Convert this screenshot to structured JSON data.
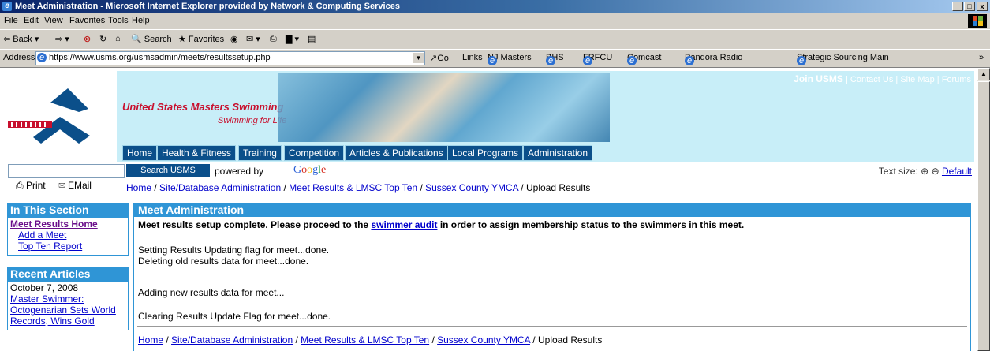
{
  "window": {
    "title": "Meet Administration - Microsoft Internet Explorer provided by Network & Computing Services"
  },
  "menu": [
    "File",
    "Edit",
    "View",
    "Favorites",
    "Tools",
    "Help"
  ],
  "toolbar": {
    "back": "Back",
    "search": "Search",
    "favorites": "Favorites"
  },
  "addressbar": {
    "label": "Address",
    "url": "https://www.usms.org/usmsadmin/meets/resultssetup.php",
    "go": "Go",
    "links_label": "Links",
    "links": [
      "NJ Masters",
      "BHS",
      "FRFCU",
      "Comcast",
      "Pandora Radio",
      "Strategic Sourcing Main"
    ]
  },
  "site": {
    "brand": "United States Masters Swimming",
    "tagline": "Swimming for Life",
    "nav": [
      "Home",
      "Health & Fitness",
      "Training",
      "Competition",
      "Articles & Publications",
      "Local Programs",
      "Administration"
    ],
    "join": "Join USMS",
    "toplinks": [
      "Contact Us",
      "Site Map",
      "Forums"
    ]
  },
  "search": {
    "button": "Search USMS",
    "powered": "powered by",
    "google": "Google",
    "text_size": "Text size:",
    "default": "Default",
    "print": "Print",
    "email": "EMail"
  },
  "breadcrumb": {
    "links": [
      "Home",
      "Site/Database Administration",
      "Meet Results & LMSC Top Ten",
      "Sussex County YMCA"
    ],
    "current": "Upload Results"
  },
  "sidebar": {
    "section_title": "In This Section",
    "section_links": [
      "Meet Results Home",
      "Add a Meet",
      "Top Ten Report"
    ],
    "recent_title": "Recent Articles",
    "date": "October 7, 2008",
    "articles": [
      "Master Swimmer: Octogenarian Sets World Records, Wins Gold"
    ]
  },
  "main": {
    "title": "Meet Administration",
    "msg_pre": "Meet results setup complete. Please proceed to the",
    "msg_link": "swimmer audit",
    "msg_post": "in order to assign membership status to the swimmers in this meet.",
    "log1": "Setting Results Updating flag for meet...done.",
    "log2": "Deleting old results data for meet...done.",
    "log3": "Adding new results data for meet...",
    "log4": "Clearing Results Update Flag for meet...done."
  }
}
